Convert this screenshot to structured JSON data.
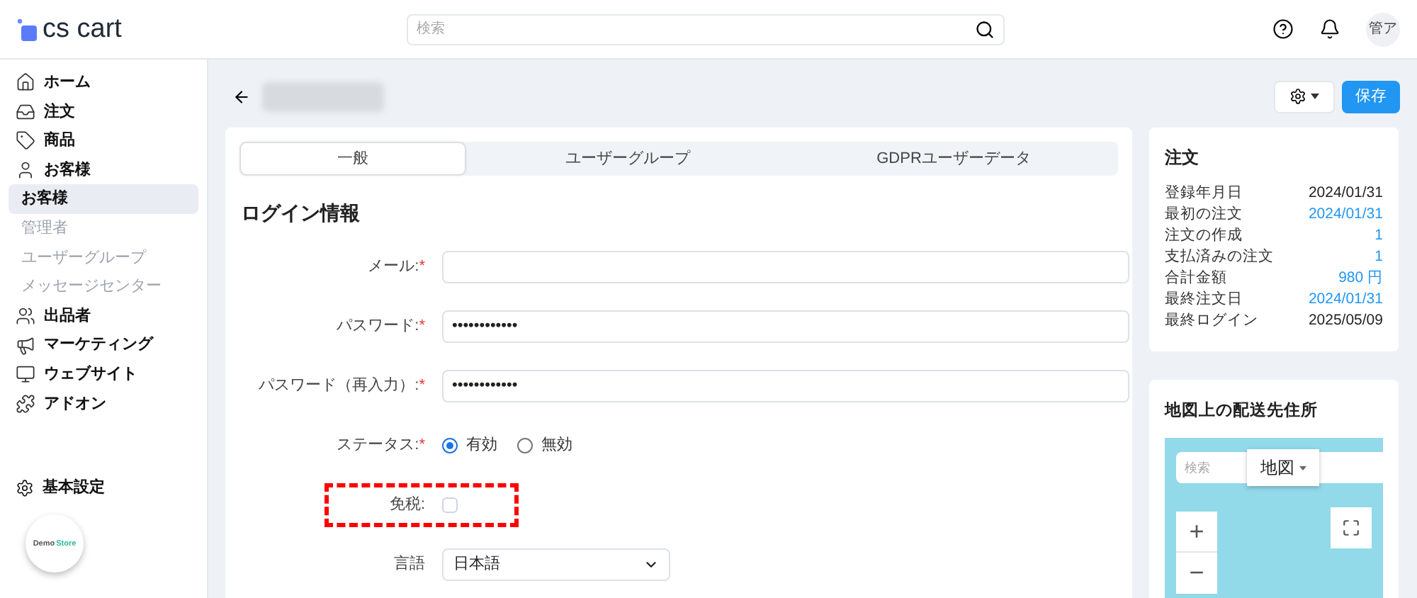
{
  "header": {
    "logo": "cs cart",
    "search": {
      "placeholder": "検索"
    },
    "avatar": "管ア"
  },
  "sidebar": {
    "items": [
      {
        "kind": "main",
        "label": "ホーム",
        "selected": false
      },
      {
        "kind": "main",
        "label": "注文",
        "selected": false
      },
      {
        "kind": "main",
        "label": "商品",
        "selected": false
      },
      {
        "kind": "main",
        "label": "お客様",
        "selected": false
      },
      {
        "kind": "sub",
        "label": "お客様",
        "selected": true
      },
      {
        "kind": "sub",
        "label": "管理者",
        "selected": false
      },
      {
        "kind": "sub",
        "label": "ユーザーグループ",
        "selected": false
      },
      {
        "kind": "sub",
        "label": "メッセージセンター",
        "selected": false
      },
      {
        "kind": "main",
        "label": "出品者",
        "selected": false
      },
      {
        "kind": "main",
        "label": "マーケティング",
        "selected": false
      },
      {
        "kind": "main",
        "label": "ウェブサイト",
        "selected": false
      },
      {
        "kind": "main",
        "label": "アドオン",
        "selected": false
      }
    ],
    "settings": "基本設定",
    "store_badge": {
      "first": "Demo",
      "second": "Store"
    }
  },
  "toolbar": {
    "save": "保存"
  },
  "tabs": [
    {
      "label": "一般",
      "selected": true
    },
    {
      "label": "ユーザーグループ",
      "selected": false
    },
    {
      "label": "GDPRユーザーデータ",
      "selected": false
    }
  ],
  "section_title": "ログイン情報",
  "fields": [
    {
      "kind": "text",
      "label": "メール:",
      "required_mark": "*",
      "highlighted": false
    },
    {
      "kind": "text",
      "label": "パスワード:",
      "required_mark": "*",
      "value": "••••••••••••",
      "highlighted": false
    },
    {
      "kind": "text",
      "label": "パスワード（再入力）:",
      "required_mark": "*",
      "value": "••••••••••••",
      "highlighted": false
    },
    {
      "kind": "radio",
      "label": "ステータス:",
      "required_mark": "*",
      "options": [
        {
          "label": "有効",
          "selected": true
        },
        {
          "label": "無効",
          "selected": false
        }
      ],
      "highlighted": false
    },
    {
      "kind": "checkbox",
      "label": "免税:",
      "checked": false,
      "highlighted": true
    },
    {
      "kind": "select",
      "label": "言語",
      "value": "日本語",
      "highlighted": false
    }
  ],
  "orders_card": {
    "title": "注文",
    "rows": [
      {
        "label": "登録年月日",
        "value": "2024/01/31",
        "link": false
      },
      {
        "label": "最初の注文",
        "value": "2024/01/31",
        "link": true
      },
      {
        "label": "注文の作成",
        "value": "1",
        "link": true
      },
      {
        "label": "支払済みの注文",
        "value": "1",
        "link": true
      },
      {
        "label": "合計金額",
        "value": "980 円",
        "link": true
      },
      {
        "label": "最終注文日",
        "value": "2024/01/31",
        "link": true
      },
      {
        "label": "最終ログイン",
        "value": "2025/05/09",
        "link": false
      }
    ]
  },
  "map_card": {
    "title": "地図上の配送先住所",
    "search_placeholder": "検索",
    "map_type": "地図",
    "zoom_in": "+",
    "zoom_out": "−"
  }
}
